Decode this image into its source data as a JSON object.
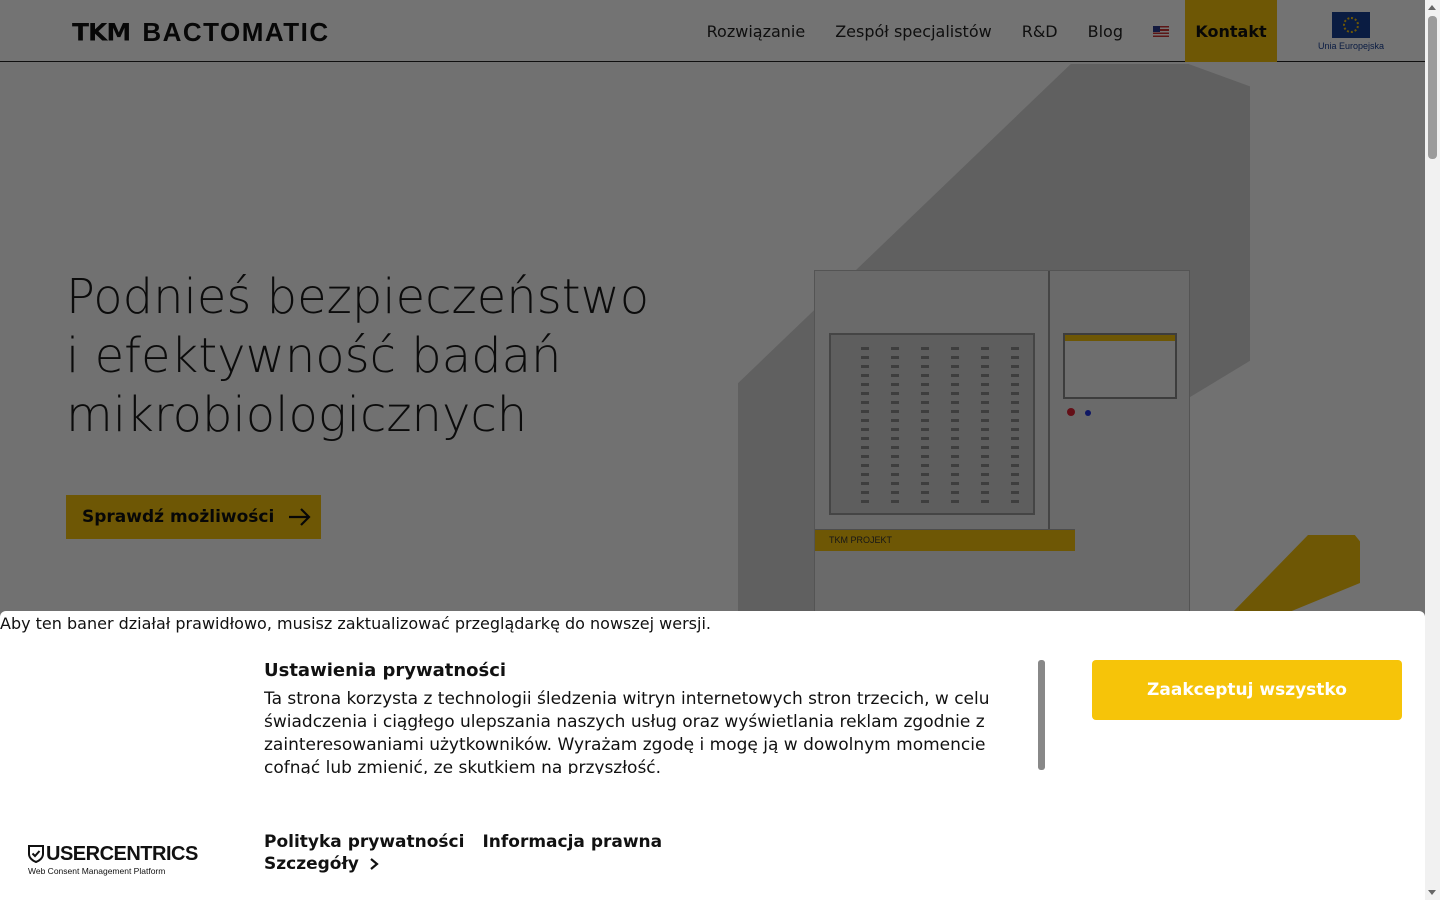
{
  "header": {
    "logo_mark": "TKM",
    "logo_text": "BACTOMATIC",
    "nav": [
      {
        "label": "Rozwiązanie"
      },
      {
        "label": "Zespół specjalistów"
      },
      {
        "label": "R&D"
      },
      {
        "label": "Blog"
      }
    ],
    "language_flag": "us-flag-icon",
    "contact_label": "Kontakt",
    "eu_label": "Unia Europejska"
  },
  "hero": {
    "title_lines": [
      "Podnieś bezpieczeństwo",
      "i efektywność badań",
      "mikrobiologicznych"
    ],
    "cta_label": "Sprawdź możliwości",
    "machine_brand": "TKM PROJEKT"
  },
  "consent": {
    "browser_warning": "Aby ten baner działał prawidłowo, musisz zaktualizować przeglądarkę do nowszej wersji.",
    "title": "Ustawienia prywatności",
    "text": "Ta strona korzysta z technologii śledzenia witryn internetowych stron trzecich, w celu świadczenia i ciągłego ulepszania naszych usług oraz wyświetlania reklam zgodnie z zainteresowaniami użytkowników. Wyrażam zgodę i mogę ją w dowolnym momencie cofnąć lub zmienić, ze skutkiem na przyszłość.",
    "accept_label": "Zaakceptuj wszystko",
    "links": [
      "Polityka prywatności",
      "Informacja prawna"
    ],
    "details_label": "Szczegóły",
    "provider_name": "USERCENTRICS",
    "provider_subtitle": "Web Consent Management Platform"
  },
  "colors": {
    "accent": "#f4c20d",
    "accept_button": "#f6c409",
    "eu_blue": "#173e93"
  }
}
